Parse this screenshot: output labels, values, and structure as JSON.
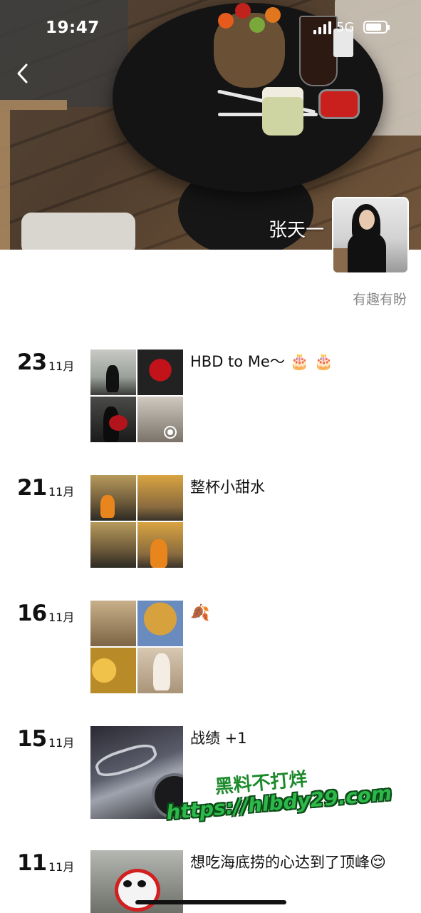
{
  "status_bar": {
    "time": "19:47",
    "network": "5G",
    "battery_level": 0.8
  },
  "profile": {
    "name": "张天一",
    "signature": "有趣有盼"
  },
  "posts": [
    {
      "day": "23",
      "month": "11月",
      "caption": "HBD to Me～",
      "emoji": "🎂 🎂"
    },
    {
      "day": "21",
      "month": "11月",
      "caption": "整杯小甜水",
      "emoji": ""
    },
    {
      "day": "16",
      "month": "11月",
      "caption": "",
      "emoji": "🍂"
    },
    {
      "day": "15",
      "month": "11月",
      "caption": "战绩 +1",
      "emoji": ""
    },
    {
      "day": "11",
      "month": "11月",
      "caption": "想吃海底捞的心达到了顶峰",
      "emoji": "😌"
    }
  ],
  "watermark": {
    "line1": "黑料不打烊",
    "line2": "https://hlbdy29.com"
  },
  "icons": {
    "back": "chevron-left-icon",
    "signal": "cellular-signal-icon",
    "battery": "battery-icon",
    "video": "video-play-icon"
  }
}
